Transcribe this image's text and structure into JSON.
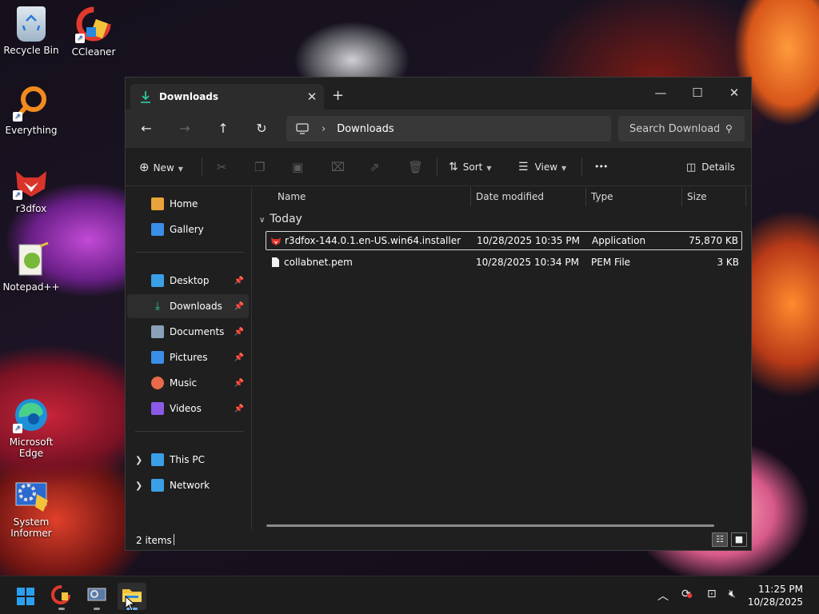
{
  "desktop": {
    "icons": [
      {
        "label": "Recycle Bin",
        "icon": "recycle-bin-icon"
      },
      {
        "label": "CCleaner",
        "icon": "ccleaner-icon"
      },
      {
        "label": "Everything",
        "icon": "everything-search-icon"
      },
      {
        "label": "r3dfox",
        "icon": "r3dfox-icon"
      },
      {
        "label": "Notepad++",
        "icon": "notepad-plus-plus-icon"
      },
      {
        "label": "Microsoft Edge",
        "icon": "edge-icon"
      },
      {
        "label": "System Informer",
        "icon": "system-informer-icon"
      }
    ]
  },
  "window": {
    "tab_title": "Downloads",
    "tab_close": "✕",
    "new_tab": "+",
    "controls": {
      "minimize": "—",
      "maximize": "☐",
      "close": "✕"
    },
    "address": {
      "root_icon": "this-pc-icon",
      "separator": "›",
      "crumb": "Downloads"
    },
    "search_placeholder": "Search Downloads",
    "toolbar": {
      "new_label": "New",
      "sort_label": "Sort",
      "view_label": "View",
      "more_label": "•••",
      "details_label": "Details"
    },
    "sidebar": {
      "top": [
        {
          "label": "Home",
          "icon": "home-icon",
          "color": "#e8a33a"
        },
        {
          "label": "Gallery",
          "icon": "gallery-icon",
          "color": "#3a8ee6"
        }
      ],
      "pinned": [
        {
          "label": "Desktop",
          "icon": "desktop-folder-icon",
          "color": "#3aa0e6",
          "selected": false
        },
        {
          "label": "Downloads",
          "icon": "downloads-folder-icon",
          "color": "#2ec4a0",
          "selected": true
        },
        {
          "label": "Documents",
          "icon": "documents-folder-icon",
          "color": "#8aa0b8",
          "selected": false
        },
        {
          "label": "Pictures",
          "icon": "pictures-folder-icon",
          "color": "#3a8ee6",
          "selected": false
        },
        {
          "label": "Music",
          "icon": "music-folder-icon",
          "color": "#e86a4a",
          "selected": false
        },
        {
          "label": "Videos",
          "icon": "videos-folder-icon",
          "color": "#8a5ae6",
          "selected": false
        }
      ],
      "bottom": [
        {
          "label": "This PC",
          "icon": "this-pc-icon",
          "color": "#3aa0e6"
        },
        {
          "label": "Network",
          "icon": "network-icon",
          "color": "#3aa0e6"
        }
      ]
    },
    "columns": {
      "name": "Name",
      "date": "Date modified",
      "type": "Type",
      "size": "Size"
    },
    "group_label": "Today",
    "files": [
      {
        "name": "r3dfox-144.0.1.en-US.win64.installer",
        "date": "10/28/2025 10:35 PM",
        "type": "Application",
        "size": "75,870 KB",
        "icon": "r3dfox-installer-icon",
        "selected": true
      },
      {
        "name": "collabnet.pem",
        "date": "10/28/2025 10:34 PM",
        "type": "PEM File",
        "size": "3 KB",
        "icon": "file-icon",
        "selected": false
      }
    ],
    "status": {
      "item_count": "2 items"
    }
  },
  "taskbar": {
    "clock_time": "11:25 PM",
    "clock_date": "10/28/2025"
  }
}
